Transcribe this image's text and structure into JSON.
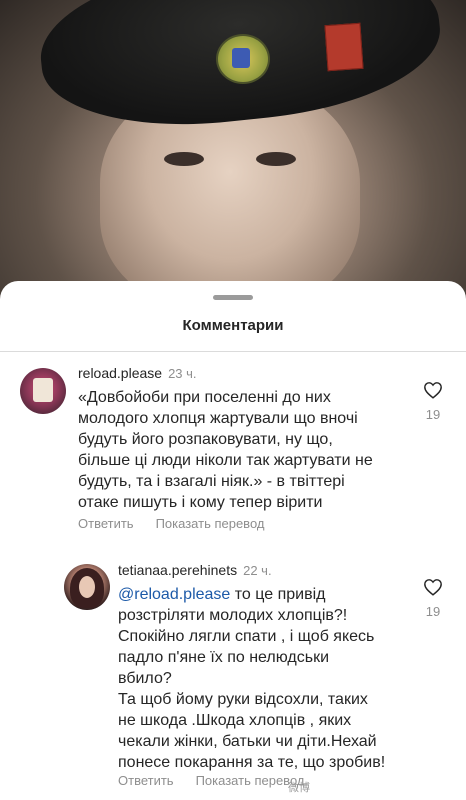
{
  "sheet": {
    "title": "Комментарии"
  },
  "comments": [
    {
      "username": "reload.please",
      "time": "23 ч.",
      "text": "«Довбойоби при поселенні до них\nмолодого хлопця жартували що вночі\nбудуть його розпаковувати, ну що,\nбільше ці люди ніколи так жартувати не\nбудуть, та і взагалі ніяк.» - в твіттері\nотаке пишуть і кому тепер вірити",
      "likes": "19",
      "reply_label": "Ответить",
      "translate_label": "Показать перевод"
    },
    {
      "username": "tetianaa.perehinets",
      "time": "22 ч.",
      "mention": "@reload.please",
      "text": " то це привід\nрозстріляти молодих хлопців?!\nСпокійно лягли спати ,  і щоб якесь\nпадло п'яне їх по нелюдськи\nвбило?\nТа щоб йому руки відсохли, таких\nне шкода .Шкода хлопців , яких\nчекали жінки, батьки чи діти.Нехай\nпонесе покарання за те, що зробив!",
      "likes": "19",
      "reply_label": "Ответить",
      "translate_label": "Показать перевод"
    }
  ],
  "icons": {
    "like": "heart-icon"
  },
  "watermark": "微博"
}
